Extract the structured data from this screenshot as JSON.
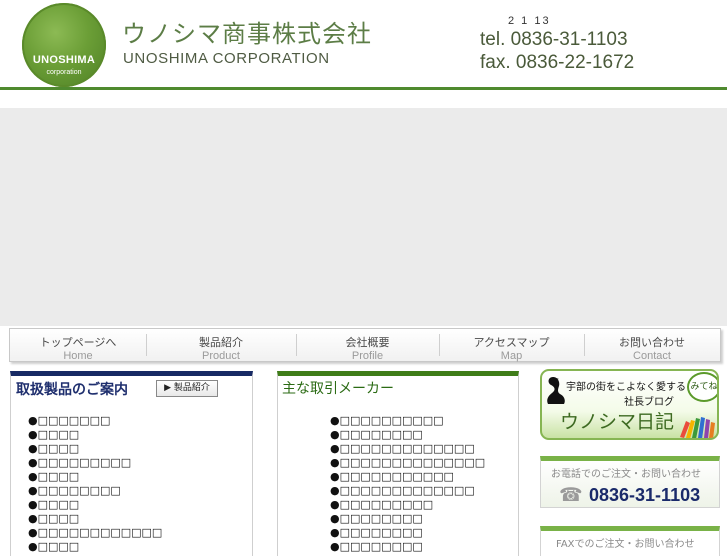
{
  "header": {
    "logo_main": "UNOSHIMA",
    "logo_sub": "corporation",
    "company_jp": "ウノシマ商事株式会社",
    "company_en": "UNOSHIMA CORPORATION",
    "address": "2 1 13",
    "tel": "tel. 0836-31-1103",
    "fax": "fax. 0836-22-1672"
  },
  "nav": {
    "items": [
      {
        "jp": "トップページへ",
        "en": "Home"
      },
      {
        "jp": "製品紹介",
        "en": "Product"
      },
      {
        "jp": "会社概要",
        "en": "Profile"
      },
      {
        "jp": "アクセスマップ",
        "en": "Map"
      },
      {
        "jp": "お問い合わせ",
        "en": "Contact"
      }
    ]
  },
  "products": {
    "title": "取扱製品のご案内",
    "button": "▶ 製品紹介",
    "items": [
      "●□□□□□□□",
      "●□□□□",
      "●□□□□",
      "●□□□□□□□□□",
      "●□□□□",
      "●□□□□□□□□",
      "●□□□□",
      "●□□□□",
      "●□□□□□□□□□□□□",
      "●□□□□"
    ]
  },
  "makers": {
    "title": "主な取引メーカー",
    "items": [
      "●□□□□□□□□□□",
      "●□□□□□□□□",
      "●□□□□□□□□□□□□□",
      "●□□□□□□□□□□□□□□",
      "●□□□□□□□□□□□",
      "●□□□□□□□□□□□□□",
      "●□□□□□□□□□",
      "●□□□□□□□□",
      "●□□□□□□□□",
      "●□□□□□□□□"
    ]
  },
  "blog": {
    "line1": "宇部の街をこよなく愛する",
    "line2": "社長ブログ",
    "bubble": "みてね",
    "title": "ウノシマ日記"
  },
  "phone": {
    "label": "お電話でのご注文・お問い合わせ",
    "icon": "telephone-icon",
    "number": "0836-31-1103"
  },
  "fax_box": {
    "label": "FAXでのご注文・お問い合わせ"
  },
  "colors": {
    "accent_green": "#4f8a2f",
    "navy": "#172a64",
    "banner_gray": "#ebebeb"
  }
}
